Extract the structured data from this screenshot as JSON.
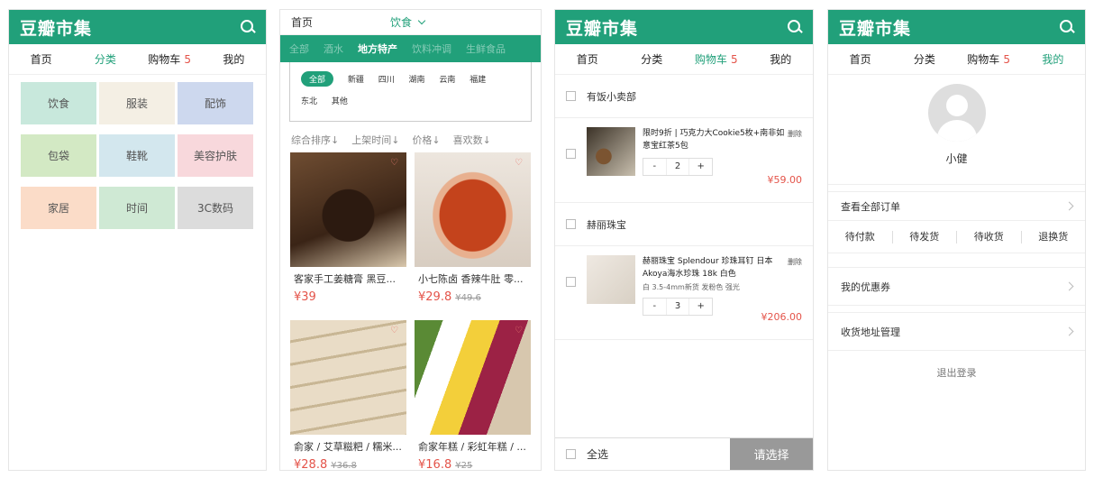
{
  "app": {
    "logo": "豆瓣市集"
  },
  "nav": {
    "home": "首页",
    "category": "分类",
    "cart": "购物车",
    "cart_count": "5",
    "mine": "我的"
  },
  "categories": [
    {
      "label": "饮食",
      "color": "#c8e8dc"
    },
    {
      "label": "服装",
      "color": "#f4efe4"
    },
    {
      "label": "配饰",
      "color": "#cdd8ee"
    },
    {
      "label": "包袋",
      "color": "#d3e9c4"
    },
    {
      "label": "鞋靴",
      "color": "#d3e7ee"
    },
    {
      "label": "美容护肤",
      "color": "#f8d8dc"
    },
    {
      "label": "家居",
      "color": "#fbdcc8"
    },
    {
      "label": "时间",
      "color": "#cfe9d4"
    },
    {
      "label": "3C数码",
      "color": "#dcdcdc"
    }
  ],
  "browse": {
    "home": "首页",
    "current_category": "饮食",
    "subtabs": [
      "全部",
      "酒水",
      "地方特产",
      "饮料冲调",
      "生鲜食品"
    ],
    "regions": [
      "全部",
      "新疆",
      "四川",
      "湖南",
      "云南",
      "福建",
      "东北",
      "其他"
    ],
    "sort": [
      "综合排序↓",
      "上架时间↓",
      "价格↓",
      "喜欢数↓"
    ],
    "products": [
      {
        "name": "客家手工姜糖膏 黑豆...",
        "price": "¥39",
        "old": ""
      },
      {
        "name": "小七陈卤 香辣牛肚 零...",
        "price": "¥29.8",
        "old": "¥49.6"
      },
      {
        "name": "俞家 / 艾草糍粑 / 糯米...",
        "price": "¥28.8",
        "old": "¥36.8"
      },
      {
        "name": "俞家年糕 / 彩虹年糕 / ...",
        "price": "¥16.8",
        "old": "¥25"
      }
    ]
  },
  "cart": {
    "shops": [
      {
        "name": "有饭小卖部",
        "item": {
          "title": "限时9折 | 巧克力大Cookie5枚+南非如意宝红茶5包",
          "spec": "",
          "qty": "2",
          "price": "¥59.00",
          "delete": "删除"
        }
      },
      {
        "name": "赫丽珠宝",
        "item": {
          "title": "赫丽珠宝 Splendour 珍珠耳钉 日本Akoya海水珍珠 18k 白色",
          "spec": "白 3.5-4mm新货 发粉色 强光",
          "qty": "3",
          "price": "¥206.00",
          "delete": "删除"
        }
      }
    ],
    "select_all": "全选",
    "checkout": "请选择",
    "minus": "-",
    "plus": "+"
  },
  "profile": {
    "username": "小健",
    "all_orders": "查看全部订单",
    "order_states": [
      "待付款",
      "待发货",
      "待收货",
      "退换货"
    ],
    "coupons": "我的优惠券",
    "address": "收货地址管理",
    "logout": "退出登录"
  },
  "colors": {
    "brand": "#21a07a",
    "price": "#e4544a"
  }
}
